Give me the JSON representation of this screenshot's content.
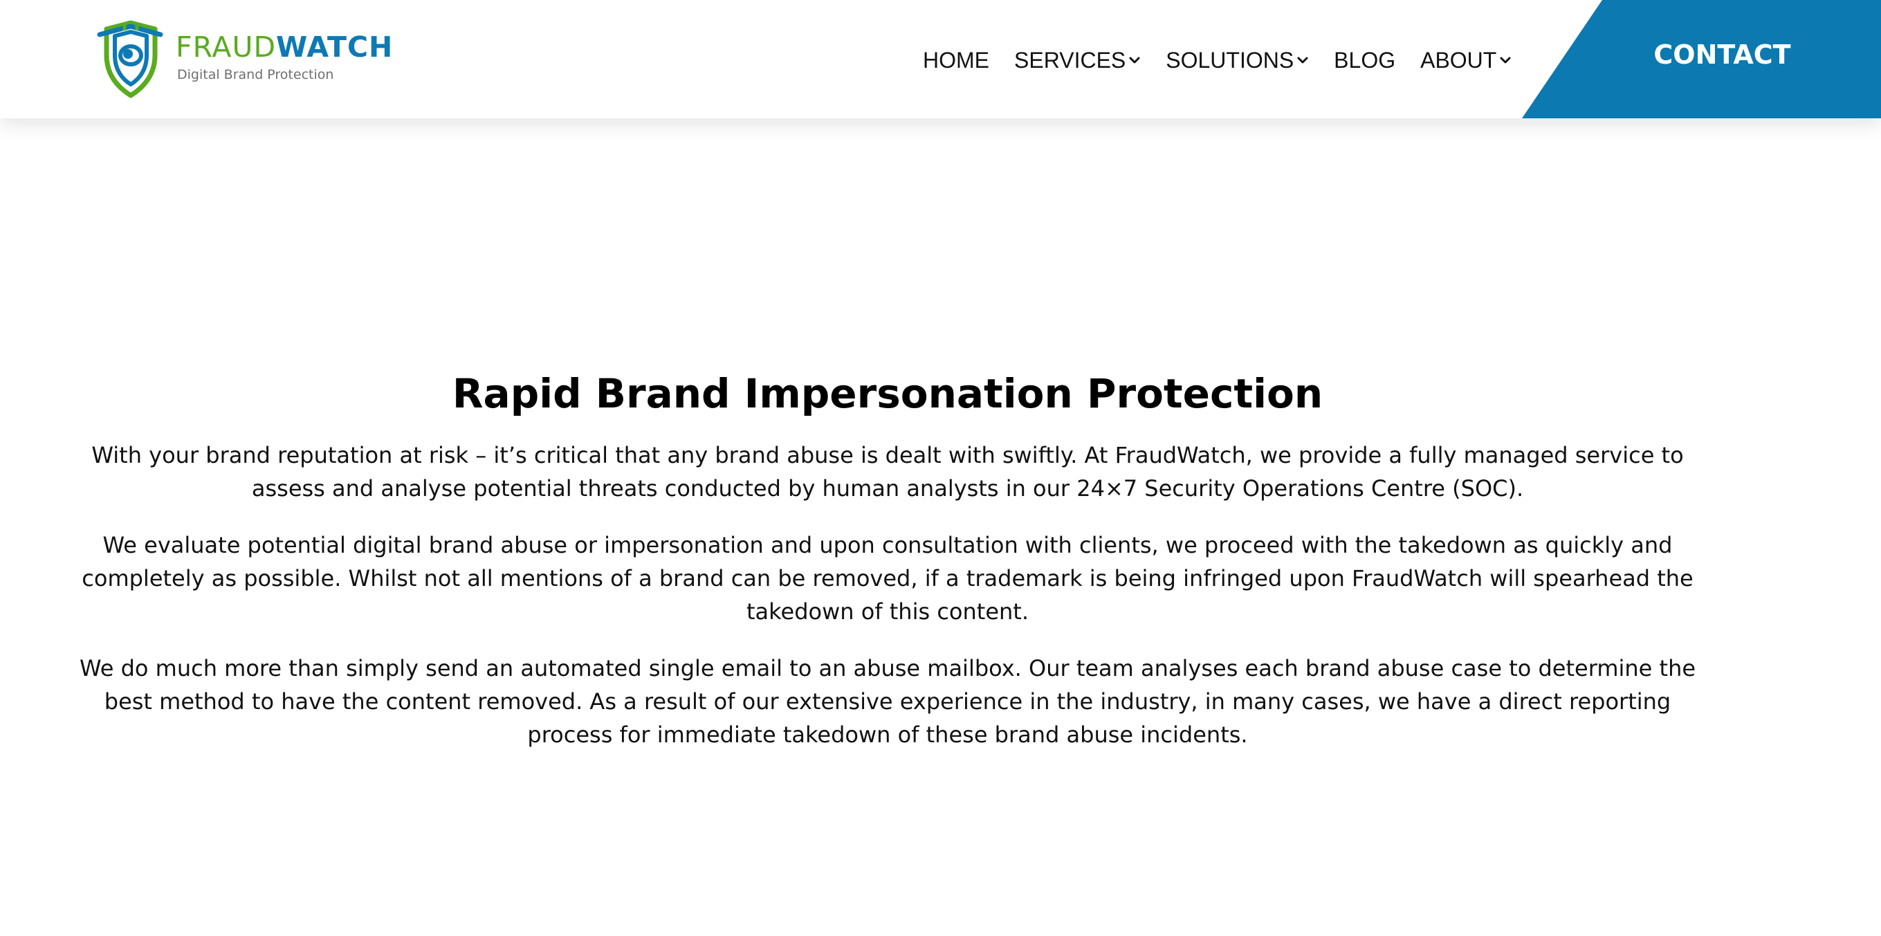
{
  "brand": {
    "word_part1": "FRAUD",
    "word_part2": "WATCH",
    "tagline": "Digital Brand Protection",
    "colors": {
      "green": "#5aab1e",
      "blue": "#0d79b5"
    },
    "icon": "shield-eye-logo"
  },
  "nav": {
    "items": [
      {
        "label": "HOME",
        "has_dropdown": false
      },
      {
        "label": "SERVICES",
        "has_dropdown": true
      },
      {
        "label": "SOLUTIONS",
        "has_dropdown": true
      },
      {
        "label": "BLOG",
        "has_dropdown": false
      },
      {
        "label": "ABOUT",
        "has_dropdown": true
      }
    ],
    "dropdown_icon": "chevron-down-icon"
  },
  "contact": {
    "label": "CONTACT",
    "color": "#0c79b0"
  },
  "main": {
    "heading": "Rapid Brand Impersonation Protection",
    "paragraphs": [
      "With your brand reputation at risk – it’s critical that any brand abuse is dealt with swiftly. At FraudWatch, we provide a fully managed service to assess and analyse potential threats conducted by human analysts in our 24×7 Security Operations Centre (SOC).",
      "We evaluate potential digital brand abuse or impersonation and upon consultation with clients, we proceed with the takedown as quickly and completely as possible. Whilst not all mentions of a brand can be removed, if a trademark is being infringed upon FraudWatch will spearhead the takedown of this content.",
      "We do much more than simply send an automated single email to an abuse mailbox. Our team analyses each brand abuse case to determine the best method to have the content removed. As a result of our extensive experience in the industry, in many cases, we have a direct reporting process for immediate takedown of these brand abuse incidents."
    ]
  }
}
